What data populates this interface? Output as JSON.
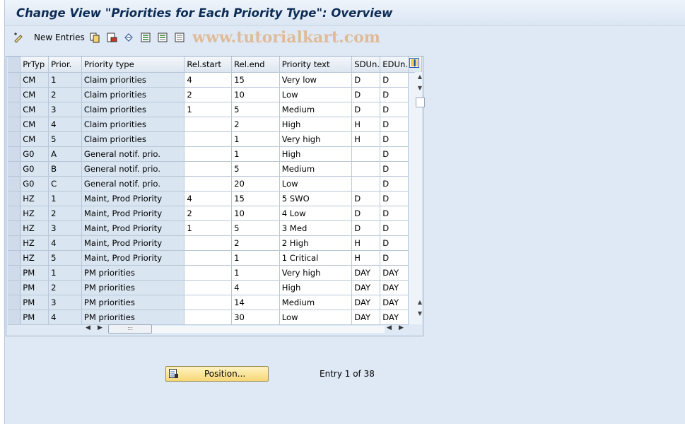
{
  "window": {
    "title": "Change View \"Priorities for Each Priority Type\": Overview"
  },
  "toolbar": {
    "new_entries_label": "New Entries",
    "watermark": "www.tutorialkart.com",
    "icons": [
      "edit-pen-icon",
      "copy-icon",
      "delete-icon",
      "undo-icon",
      "select-all-icon",
      "select-block-icon",
      "deselect-all-icon"
    ]
  },
  "table": {
    "columns": [
      "PrTyp",
      "Prior.",
      "Priority type",
      "Rel.start",
      "Rel.end",
      "Priority text",
      "SDUn.",
      "EDUn."
    ],
    "rows": [
      [
        "CM",
        "1",
        "Claim priorities",
        "4",
        "15",
        "Very low",
        "D",
        "D"
      ],
      [
        "CM",
        "2",
        "Claim priorities",
        "2",
        "10",
        "Low",
        "D",
        "D"
      ],
      [
        "CM",
        "3",
        "Claim priorities",
        "1",
        "5",
        "Medium",
        "D",
        "D"
      ],
      [
        "CM",
        "4",
        "Claim priorities",
        "",
        "2",
        "High",
        "H",
        "D"
      ],
      [
        "CM",
        "5",
        "Claim priorities",
        "",
        "1",
        "Very high",
        "H",
        "D"
      ],
      [
        "G0",
        "A",
        "General notif. prio.",
        "",
        "1",
        "High",
        "",
        "D"
      ],
      [
        "G0",
        "B",
        "General notif. prio.",
        "",
        "5",
        "Medium",
        "",
        "D"
      ],
      [
        "G0",
        "C",
        "General notif. prio.",
        "",
        "20",
        "Low",
        "",
        "D"
      ],
      [
        "HZ",
        "1",
        "Maint, Prod Priority",
        "4",
        "15",
        "5 SWO",
        "D",
        "D"
      ],
      [
        "HZ",
        "2",
        "Maint, Prod Priority",
        "2",
        "10",
        "4 Low",
        "D",
        "D"
      ],
      [
        "HZ",
        "3",
        "Maint, Prod Priority",
        "1",
        "5",
        "3 Med",
        "D",
        "D"
      ],
      [
        "HZ",
        "4",
        "Maint, Prod Priority",
        "",
        "2",
        "2 High",
        "H",
        "D"
      ],
      [
        "HZ",
        "5",
        "Maint, Prod Priority",
        "",
        "1",
        "1 Critical",
        "H",
        "D"
      ],
      [
        "PM",
        "1",
        "PM priorities",
        "",
        "1",
        "Very high",
        "DAY",
        "DAY"
      ],
      [
        "PM",
        "2",
        "PM priorities",
        "",
        "4",
        "High",
        "DAY",
        "DAY"
      ],
      [
        "PM",
        "3",
        "PM priorities",
        "",
        "14",
        "Medium",
        "DAY",
        "DAY"
      ],
      [
        "PM",
        "4",
        "PM priorities",
        "",
        "30",
        "Low",
        "DAY",
        "DAY"
      ]
    ]
  },
  "footer": {
    "position_button_label": "Position...",
    "entry_info": "Entry 1 of 38"
  }
}
